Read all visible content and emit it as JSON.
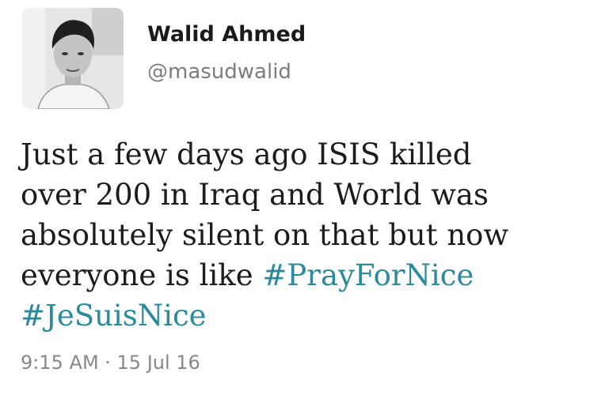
{
  "author": {
    "display_name": "Walid Ahmed",
    "handle": "@masudwalid"
  },
  "tweet": {
    "lines": [
      "Just a few days ago ISIS killed",
      "over 200 in Iraq and World was",
      "absolutely silent on that but now",
      "everyone is like "
    ],
    "hashtags": [
      "#PrayForNice",
      "#JeSuisNice"
    ],
    "timestamp": "9:15 AM · 15 Jul 16"
  },
  "colors": {
    "hashtag": "#2b8a9c",
    "secondary_text": "#7d7d7d"
  },
  "icons": {
    "avatar": "profile-photo"
  }
}
